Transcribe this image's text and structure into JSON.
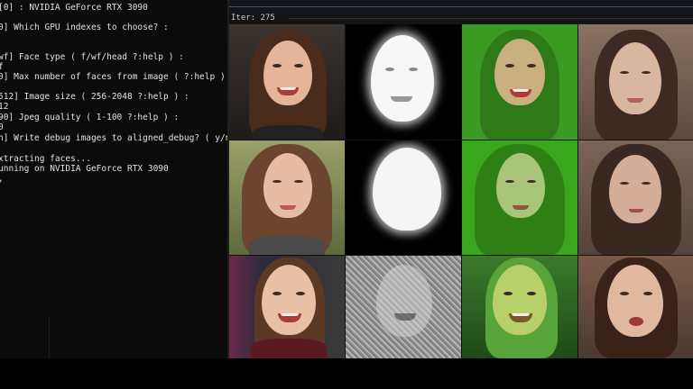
{
  "terminal": {
    "lines": [
      "[0] : NVIDIA GeForce RTX 3090",
      "",
      "0] Which GPU indexes to choose? :",
      "",
      "",
      "wf] Face type ( f/wf/head ?:help ) :",
      "f",
      "0] Max number of faces from image ( ?:help ) :",
      "",
      "",
      "512] Image size ( 256-2048 ?:help ) :",
      "12",
      "90] Jpeg quality ( 1-100 ?:help ) :",
      "0",
      "n] Write debug images to aligned_debug? ( y/n ) :",
      "",
      "xtracting faces...",
      "unning on NVIDIA GeForce RTX 3090",
      ","
    ]
  },
  "preview": {
    "iter_label": "Iter: 275",
    "rows": [
      [
        "source-face",
        "mask",
        "green-overlay",
        "predicted-face"
      ],
      [
        "source-face",
        "mask",
        "green-overlay",
        "predicted-face"
      ],
      [
        "source-face",
        "noise-map",
        "green-overlay",
        "predicted-face"
      ]
    ]
  },
  "colors": {
    "terminal_bg": "#0b0b0b",
    "terminal_text": "#e2e2e2",
    "overlay_green": "#3aa61c",
    "mask_white": "#ffffff"
  }
}
